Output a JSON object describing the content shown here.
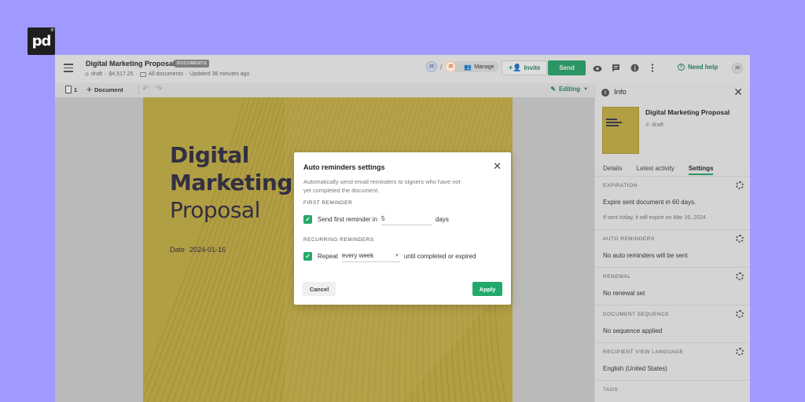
{
  "brand": {
    "logo_text": "pd",
    "logo_mark": "®"
  },
  "header": {
    "title": "Digital Marketing Proposal",
    "badge": "DOCUMENTS",
    "status": "draft",
    "amount": "$4,517.25",
    "folder": "All documents",
    "updated": "Updated 36 minutes ago",
    "avatar1": "JD",
    "slash": "/",
    "avatar2": "JD",
    "manage_label": "Manage",
    "invite_label": "Invite",
    "send_label": "Send",
    "help_label": "Need help",
    "user_avatar": "JD"
  },
  "toolbar": {
    "page_count": "1",
    "add_label": "Document",
    "mode_label": "Editing"
  },
  "document": {
    "title_line1": "Digital",
    "title_line2": "Marketing",
    "title_line3": "Proposal",
    "date_label": "Date",
    "date_value": "2024-01-16"
  },
  "panel": {
    "title": "Info",
    "doc_name": "Digital Marketing Proposal",
    "doc_status": "draft",
    "tabs": [
      "Details",
      "Latest activity",
      "Settings"
    ],
    "sections": {
      "expiration_label": "EXPIRATION",
      "expiration_text": "Expire sent document in 60 days.",
      "expiration_sub": "If sent today, it will expire on Mar 16, 2024",
      "auto_label": "AUTO REMINDERS",
      "auto_text": "No auto reminders will be sent",
      "renewal_label": "RENEWAL",
      "renewal_text": "No renewal set",
      "sequence_label": "DOCUMENT SEQUENCE",
      "sequence_text": "No sequence applied",
      "language_label": "RECIPIENT VIEW LANGUAGE",
      "language_text": "English (United States)",
      "tags_label": "TAGS"
    }
  },
  "modal": {
    "title": "Auto reminders settings",
    "description": "Automatically send email reminders to signers who have not yet completed the document.",
    "first_label": "FIRST REMINDER",
    "first_text": "Send first reminder in",
    "first_value": "5",
    "first_unit": "days",
    "recurring_label": "RECURRING REMINDERS",
    "repeat_text": "Repeat",
    "repeat_value": "every week",
    "repeat_suffix": "until completed or expired",
    "cancel_label": "Cancel",
    "apply_label": "Apply"
  },
  "colors": {
    "background": "#a09aff",
    "accent_green": "#25a86b",
    "document_yellow": "#c9b244",
    "document_text": "#2f2a42"
  },
  "icons": [
    "menu-icon",
    "folder-icon",
    "people-icon",
    "add-person-icon",
    "eye-icon",
    "comment-icon",
    "info-icon",
    "more-icon",
    "help-icon",
    "page-icon",
    "plus-icon",
    "undo-icon",
    "redo-icon",
    "pencil-icon",
    "chevron-down-icon",
    "close-icon",
    "gear-icon",
    "check-icon"
  ]
}
